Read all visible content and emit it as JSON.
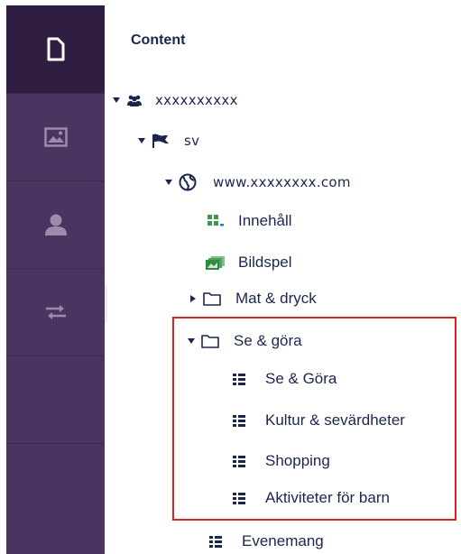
{
  "header": {
    "title": "Content"
  },
  "sidebar": {
    "sections": [
      {
        "icon": "document-icon",
        "active": true
      },
      {
        "icon": "image-icon",
        "active": false
      },
      {
        "icon": "user-icon",
        "active": false
      },
      {
        "icon": "arrows-icon",
        "active": false
      }
    ]
  },
  "tree": {
    "root": {
      "label": "xxxxxxxxxx",
      "icon": "users-icon",
      "expanded": true
    },
    "language": {
      "label": "sv",
      "icon": "flag-icon",
      "expanded": true
    },
    "site": {
      "label": "www.xxxxxxxx.com",
      "icon": "globe-icon",
      "expanded": true
    },
    "items": [
      {
        "label": "Innehåll",
        "icon": "blocks-icon"
      },
      {
        "label": "Bildspel",
        "icon": "slideshow-icon"
      },
      {
        "label": "Mat & dryck",
        "icon": "folder-icon",
        "expanded": false
      },
      {
        "label": "Se & göra",
        "icon": "folder-icon",
        "expanded": true
      },
      {
        "label": "Evenemang",
        "icon": "list-icon"
      }
    ],
    "se_gora_children": [
      {
        "label": "Se & Göra",
        "icon": "list-icon"
      },
      {
        "label": "Kultur & sevärdheter",
        "icon": "list-icon"
      },
      {
        "label": "Shopping",
        "icon": "list-icon"
      },
      {
        "label": "Aktiviteter för barn",
        "icon": "list-icon"
      }
    ]
  },
  "colors": {
    "sidebar": "#4a3460",
    "sidebar_active": "#2f1d42",
    "text": "#1b264f",
    "highlight": "#e02020"
  }
}
